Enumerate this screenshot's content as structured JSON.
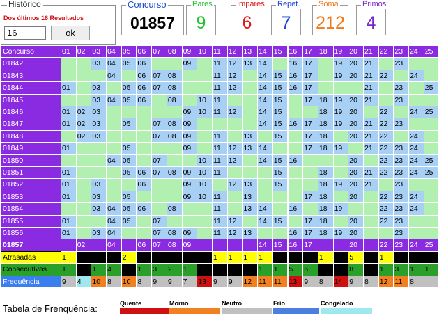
{
  "historico": {
    "title": "Histórico",
    "subtitle": "Dos últimos 16 Resultados",
    "input_value": "16",
    "ok_label": "ok"
  },
  "stats": {
    "concurso": {
      "label": "Concurso",
      "value": "01857",
      "color": "#000000"
    },
    "pares": {
      "label": "Pares",
      "value": "9",
      "color": "#22c22e"
    },
    "impares": {
      "label": "Ímpares",
      "value": "6",
      "color": "#e01818"
    },
    "repet": {
      "label": "Repet.",
      "value": "7",
      "color": "#1a44d8"
    },
    "soma": {
      "label": "Soma",
      "value": "212",
      "color": "#f07a18"
    },
    "primos": {
      "label": "Primos",
      "value": "4",
      "color": "#7a24d0"
    }
  },
  "table": {
    "header_label": "Concurso",
    "numbers": [
      "01",
      "02",
      "03",
      "04",
      "05",
      "06",
      "07",
      "08",
      "09",
      "10",
      "11",
      "12",
      "13",
      "14",
      "15",
      "16",
      "17",
      "18",
      "19",
      "20",
      "21",
      "22",
      "23",
      "24",
      "25"
    ],
    "colors": {
      "header_bg": "#8a2be2",
      "hit_bg": "#a8d0f4",
      "miss_bg": "#b2f0b2",
      "current_row_bg": "#8a2be2",
      "current_hit_text": "#ffffff",
      "current_miss_text": "#8a2be2"
    },
    "rows": [
      {
        "concurso": "01842",
        "numbers": [
          "",
          "",
          "03",
          "04",
          "05",
          "06",
          "",
          "",
          "09",
          "",
          "11",
          "12",
          "13",
          "14",
          "",
          "16",
          "17",
          "",
          "19",
          "20",
          "21",
          "",
          "23",
          "",
          ""
        ]
      },
      {
        "concurso": "01843",
        "numbers": [
          "",
          "",
          "",
          "04",
          "",
          "06",
          "07",
          "08",
          "",
          "",
          "11",
          "12",
          "",
          "14",
          "15",
          "16",
          "17",
          "",
          "19",
          "20",
          "21",
          "22",
          "",
          "24",
          ""
        ]
      },
      {
        "concurso": "01844",
        "numbers": [
          "01",
          "",
          "03",
          "",
          "05",
          "06",
          "07",
          "08",
          "",
          "",
          "11",
          "12",
          "",
          "14",
          "15",
          "16",
          "17",
          "",
          "",
          "",
          "21",
          "",
          "23",
          "",
          "25"
        ]
      },
      {
        "concurso": "01845",
        "numbers": [
          "",
          "",
          "03",
          "04",
          "05",
          "06",
          "",
          "08",
          "",
          "10",
          "11",
          "",
          "",
          "14",
          "15",
          "",
          "17",
          "18",
          "19",
          "20",
          "21",
          "",
          "23",
          "",
          ""
        ]
      },
      {
        "concurso": "01846",
        "numbers": [
          "01",
          "02",
          "03",
          "",
          "",
          "",
          "",
          "",
          "09",
          "10",
          "11",
          "12",
          "",
          "14",
          "15",
          "",
          "",
          "18",
          "19",
          "20",
          "",
          "22",
          "",
          "24",
          "25"
        ]
      },
      {
        "concurso": "01847",
        "numbers": [
          "01",
          "02",
          "03",
          "",
          "05",
          "",
          "07",
          "08",
          "09",
          "",
          "",
          "",
          "",
          "14",
          "15",
          "16",
          "17",
          "18",
          "19",
          "20",
          "21",
          "22",
          "23",
          "",
          ""
        ]
      },
      {
        "concurso": "01848",
        "numbers": [
          "",
          "02",
          "03",
          "",
          "",
          "",
          "07",
          "08",
          "09",
          "",
          "11",
          "",
          "13",
          "",
          "15",
          "",
          "17",
          "18",
          "",
          "20",
          "21",
          "22",
          "",
          "24",
          ""
        ]
      },
      {
        "concurso": "01849",
        "numbers": [
          "01",
          "",
          "",
          "",
          "05",
          "",
          "",
          "",
          "09",
          "",
          "11",
          "12",
          "13",
          "14",
          "",
          "",
          "17",
          "18",
          "19",
          "",
          "21",
          "22",
          "23",
          "24",
          ""
        ]
      },
      {
        "concurso": "01850",
        "numbers": [
          "",
          "",
          "",
          "04",
          "05",
          "",
          "07",
          "",
          "",
          "10",
          "11",
          "12",
          "",
          "14",
          "15",
          "16",
          "",
          "",
          "",
          "20",
          "",
          "22",
          "23",
          "24",
          "25"
        ]
      },
      {
        "concurso": "01851",
        "numbers": [
          "01",
          "",
          "",
          "",
          "05",
          "06",
          "07",
          "08",
          "09",
          "10",
          "11",
          "",
          "",
          "",
          "15",
          "",
          "",
          "18",
          "",
          "20",
          "21",
          "22",
          "23",
          "24",
          "25"
        ]
      },
      {
        "concurso": "01852",
        "numbers": [
          "01",
          "",
          "03",
          "",
          "",
          "06",
          "",
          "",
          "09",
          "10",
          "",
          "12",
          "13",
          "",
          "15",
          "",
          "",
          "18",
          "19",
          "20",
          "21",
          "",
          "23",
          "",
          ""
        ]
      },
      {
        "concurso": "01853",
        "numbers": [
          "01",
          "",
          "03",
          "",
          "05",
          "",
          "",
          "",
          "09",
          "10",
          "11",
          "",
          "13",
          "",
          "",
          "",
          "17",
          "18",
          "",
          "20",
          "",
          "22",
          "23",
          "24",
          ""
        ]
      },
      {
        "concurso": "01854",
        "numbers": [
          "",
          "",
          "03",
          "04",
          "05",
          "06",
          "",
          "08",
          "",
          "",
          "11",
          "",
          "13",
          "14",
          "",
          "16",
          "",
          "18",
          "19",
          "",
          "",
          "22",
          "23",
          "24",
          ""
        ]
      },
      {
        "concurso": "01855",
        "numbers": [
          "01",
          "",
          "",
          "04",
          "05",
          "",
          "07",
          "",
          "",
          "",
          "11",
          "12",
          "",
          "14",
          "15",
          "",
          "17",
          "18",
          "",
          "20",
          "",
          "22",
          "23",
          "",
          ""
        ]
      },
      {
        "concurso": "01856",
        "numbers": [
          "01",
          "",
          "03",
          "04",
          "",
          "",
          "07",
          "08",
          "09",
          "",
          "11",
          "12",
          "13",
          "",
          "",
          "16",
          "17",
          "18",
          "19",
          "20",
          "",
          "",
          "23",
          "",
          ""
        ]
      }
    ],
    "current": {
      "concurso": "01857",
      "numbers": [
        "",
        "02",
        "",
        "04",
        "",
        "06",
        "07",
        "08",
        "09",
        "",
        "",
        "",
        "",
        "14",
        "15",
        "16",
        "17",
        "",
        "",
        "20",
        "",
        "22",
        "23",
        "24",
        "25"
      ]
    },
    "atrasadas": {
      "label": "Atrasadas",
      "values": [
        "1",
        "",
        "",
        "",
        "2",
        "",
        "",
        "",
        "",
        "",
        "1",
        "1",
        "1",
        "1",
        "",
        "",
        "",
        "1",
        "",
        "5",
        "",
        "1",
        "",
        "",
        ""
      ],
      "cell_colors": [
        "#ffff00",
        "#000000",
        "#000000",
        "#000000",
        "#ffff00",
        "#000000",
        "#000000",
        "#000000",
        "#000000",
        "#000000",
        "#ffff00",
        "#ffff00",
        "#ffff00",
        "#ffff00",
        "#000000",
        "#000000",
        "#000000",
        "#ffff00",
        "#000000",
        "#ffff00",
        "#000000",
        "#ffff00",
        "#000000",
        "#000000",
        "#000000"
      ]
    },
    "consecutivas": {
      "label": "Consecutivas",
      "values": [
        "1",
        "",
        "1",
        "4",
        "",
        "1",
        "3",
        "2",
        "1",
        "",
        "",
        "",
        "",
        "1",
        "1",
        "5",
        "6",
        "",
        "",
        "8",
        "",
        "1",
        "3",
        "1",
        "1"
      ],
      "cell_colors": [
        "#2aa02a",
        "#000000",
        "#2aa02a",
        "#2aa02a",
        "#000000",
        "#2aa02a",
        "#2aa02a",
        "#2aa02a",
        "#2aa02a",
        "#000000",
        "#000000",
        "#000000",
        "#000000",
        "#2aa02a",
        "#2aa02a",
        "#2aa02a",
        "#2aa02a",
        "#000000",
        "#000000",
        "#2aa02a",
        "#000000",
        "#2aa02a",
        "#2aa02a",
        "#2aa02a",
        "#2aa02a"
      ]
    },
    "frequencia": {
      "label": "Frequência",
      "values": [
        "9",
        "4",
        "10",
        "8",
        "10",
        "8",
        "9",
        "9",
        "7",
        "13",
        "9",
        "9",
        "12",
        "11",
        "11",
        "13",
        "9",
        "8",
        "14",
        "9",
        "8",
        "12",
        "11",
        "8",
        ""
      ],
      "cell_colors": [
        "#c0c0c0",
        "#a0e8f0",
        "#f08020",
        "#c0c0c0",
        "#f08020",
        "#c0c0c0",
        "#c0c0c0",
        "#c0c0c0",
        "#c0c0c0",
        "#d01010",
        "#c0c0c0",
        "#c0c0c0",
        "#f08020",
        "#f08020",
        "#f08020",
        "#d01010",
        "#c0c0c0",
        "#c0c0c0",
        "#d01010",
        "#c0c0c0",
        "#c0c0c0",
        "#f08020",
        "#f08020",
        "#c0c0c0",
        "#c0c0c0"
      ]
    }
  },
  "legend": {
    "title": "Tabela de Frenquência:",
    "items": [
      {
        "label": "Quente",
        "color": "#d01010"
      },
      {
        "label": "Morno",
        "color": "#f08020"
      },
      {
        "label": "Neutro",
        "color": "#c0c0c0"
      },
      {
        "label": "Frio",
        "color": "#4a7ee0"
      },
      {
        "label": "Congelado",
        "color": "#a0e8f0"
      }
    ]
  }
}
